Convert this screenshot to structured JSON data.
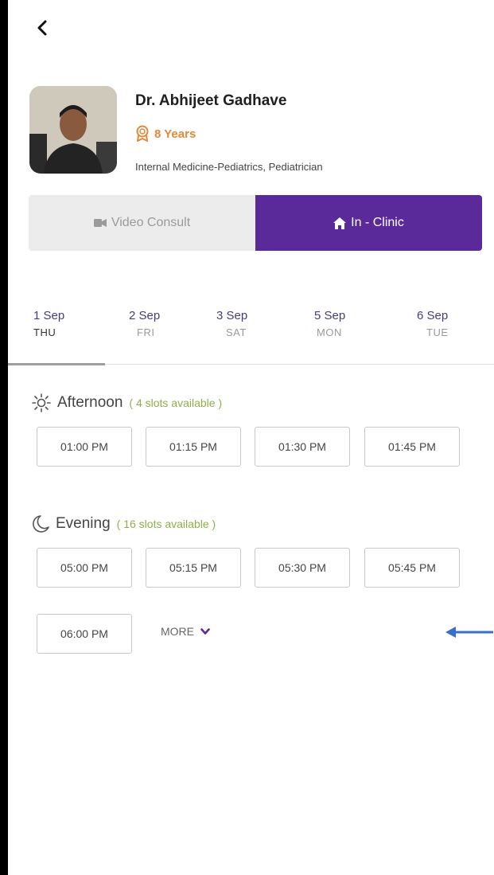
{
  "doctor": {
    "name": "Dr. Abhijeet Gadhave",
    "experience": "8 Years",
    "specialty": "Internal Medicine-Pediatrics, Pediatrician"
  },
  "mode_tabs": {
    "video_label": "Video Consult",
    "clinic_label": "In - Clinic"
  },
  "dates": [
    {
      "date": "1 Sep",
      "weekday": "THU"
    },
    {
      "date": "2 Sep",
      "weekday": "FRI"
    },
    {
      "date": "3 Sep",
      "weekday": "SAT"
    },
    {
      "date": "5 Sep",
      "weekday": "MON"
    },
    {
      "date": "6 Sep",
      "weekday": "TUE"
    }
  ],
  "afternoon": {
    "title": "Afternoon",
    "availability": "( 4 slots available )",
    "slots": [
      "01:00 PM",
      "01:15 PM",
      "01:30 PM",
      "01:45 PM"
    ]
  },
  "evening": {
    "title": "Evening",
    "availability": "( 16 slots available )",
    "slots": [
      "05:00 PM",
      "05:15 PM",
      "05:30 PM",
      "05:45 PM",
      "06:00 PM"
    ]
  },
  "more_label": "MORE",
  "colors": {
    "primary": "#5a2a9a",
    "accent_orange": "#e08a3a",
    "available_green": "#8bb04a",
    "annotation_arrow": "#3a6fc6"
  }
}
